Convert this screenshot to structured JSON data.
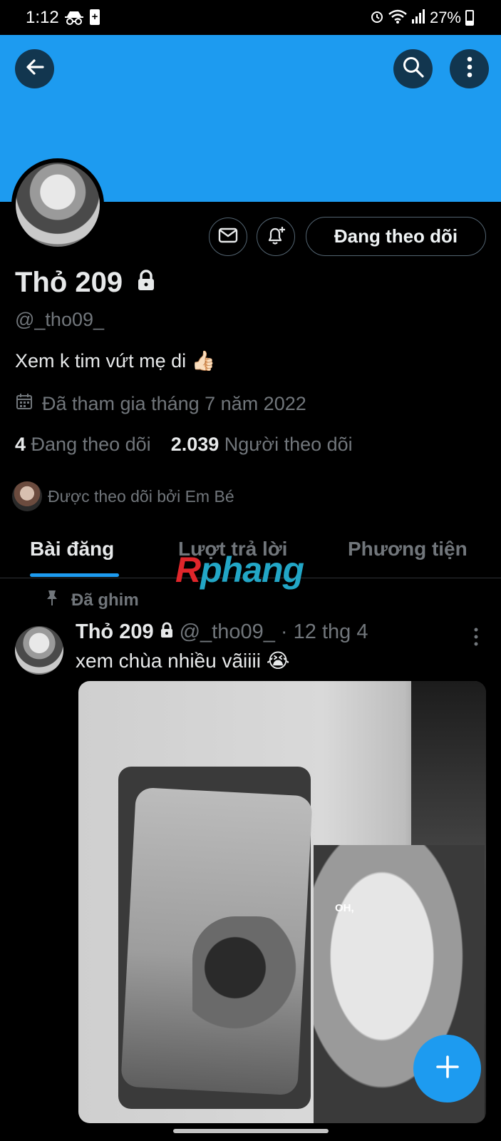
{
  "status_bar": {
    "time": "1:12",
    "battery": "27%"
  },
  "header": {
    "back_icon": "arrow-left-icon",
    "search_icon": "search-icon",
    "more_icon": "more-vertical-icon",
    "banner_color": "#1d9bf0"
  },
  "profile": {
    "name": "Thỏ 209",
    "handle": "@_tho09_",
    "bio": "Xem k tim vứt mẹ di 👍🏻",
    "joined": "Đã tham gia tháng 7 năm 2022",
    "following_count": "4",
    "following_label": "Đang theo dõi",
    "followers_count": "2.039",
    "followers_label": "Người theo dõi",
    "followed_by": "Được theo dõi bởi Em Bé",
    "follow_button": "Đang theo dõi"
  },
  "tabs": [
    {
      "label": "Bài đăng",
      "active": true
    },
    {
      "label": "Lượt trả lời",
      "active": false
    },
    {
      "label": "Phương tiện",
      "active": false
    }
  ],
  "watermark": {
    "r": "R",
    "rest": "phang"
  },
  "post": {
    "pinned_label": "Đã ghim",
    "author": "Thỏ 209",
    "meta": "@_tho09_ · 12 thg 4",
    "text": "xem chùa nhiều vãiiii 😭",
    "media_caption": "OH,"
  }
}
